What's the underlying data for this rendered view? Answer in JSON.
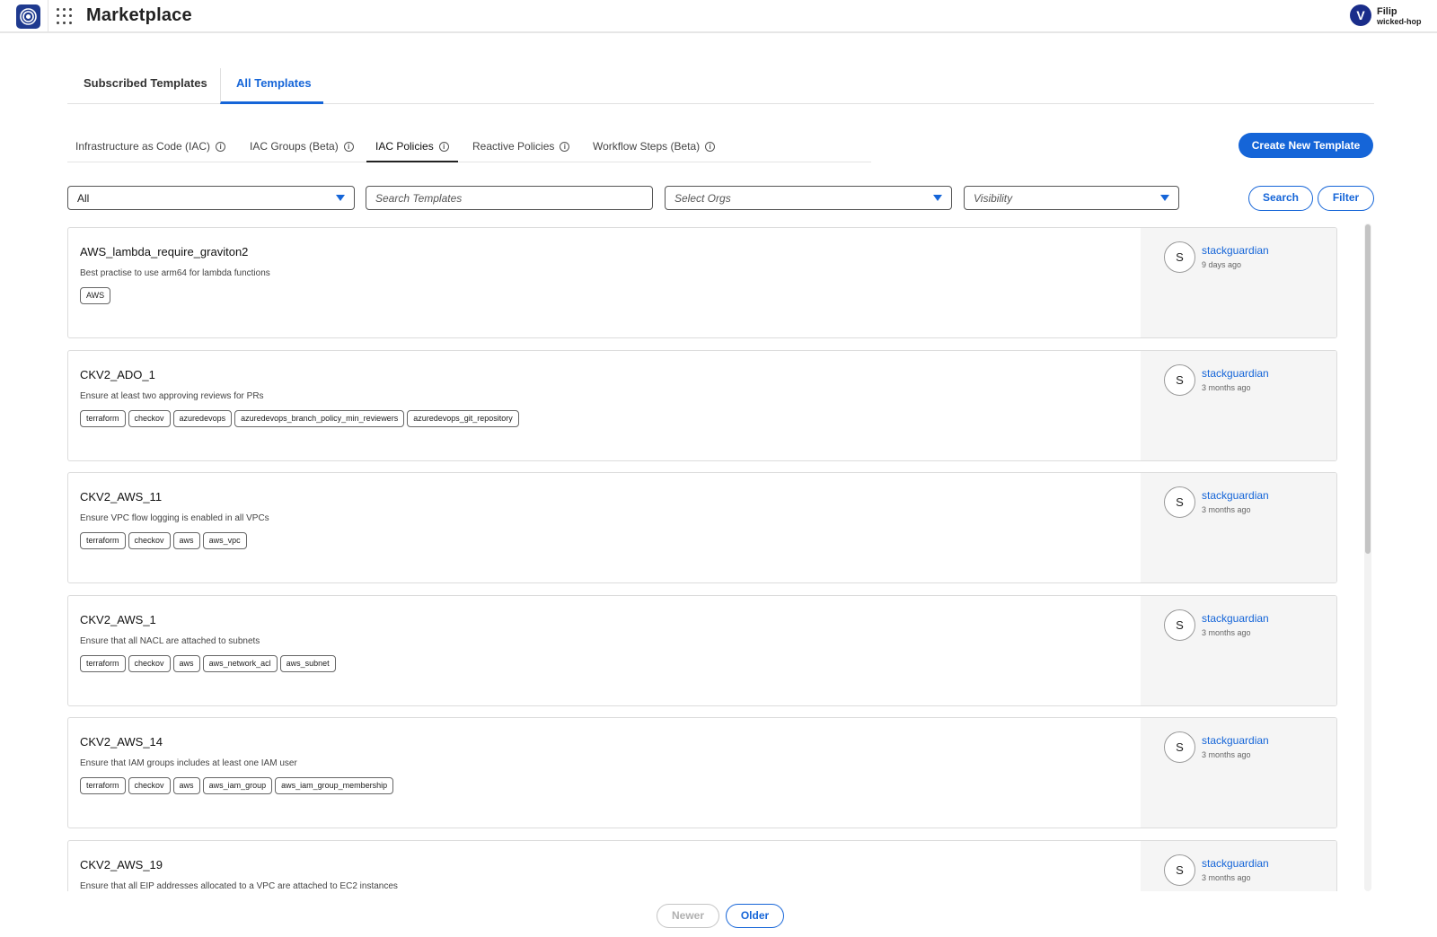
{
  "header": {
    "app_title": "Marketplace",
    "logo_icon": "stackguardian-logo-icon",
    "apps_icon": "apps-grid-icon",
    "user": {
      "avatar_letter": "V",
      "name": "Filip",
      "org": "wicked-hop"
    }
  },
  "main_tabs": [
    {
      "label": "Subscribed Templates",
      "active": false
    },
    {
      "label": "All Templates",
      "active": true
    }
  ],
  "sub_tabs": [
    {
      "label": "Infrastructure as Code (IAC)",
      "active": false
    },
    {
      "label": "IAC Groups (Beta)",
      "active": false
    },
    {
      "label": "IAC Policies",
      "active": true
    },
    {
      "label": "Reactive Policies",
      "active": false
    },
    {
      "label": "Workflow Steps (Beta)",
      "active": false
    }
  ],
  "info_icon": "i",
  "create_button": "Create New Template",
  "filters": {
    "type_select": "All",
    "search_placeholder": "Search Templates",
    "orgs_placeholder": "Select Orgs",
    "visibility_placeholder": "Visibility",
    "search_button": "Search",
    "filter_button": "Filter"
  },
  "templates": [
    {
      "title": "AWS_lambda_require_graviton2",
      "description": "Best practise to use arm64 for lambda functions",
      "tags": [
        "AWS"
      ],
      "author_initial": "S",
      "author": "stackguardian",
      "updated": "9 days ago"
    },
    {
      "title": "CKV2_ADO_1",
      "description": "Ensure at least two approving reviews for PRs",
      "tags": [
        "terraform",
        "checkov",
        "azuredevops",
        "azuredevops_branch_policy_min_reviewers",
        "azuredevops_git_repository"
      ],
      "author_initial": "S",
      "author": "stackguardian",
      "updated": "3 months ago"
    },
    {
      "title": "CKV2_AWS_11",
      "description": "Ensure VPC flow logging is enabled in all VPCs",
      "tags": [
        "terraform",
        "checkov",
        "aws",
        "aws_vpc"
      ],
      "author_initial": "S",
      "author": "stackguardian",
      "updated": "3 months ago"
    },
    {
      "title": "CKV2_AWS_1",
      "description": "Ensure that all NACL are attached to subnets",
      "tags": [
        "terraform",
        "checkov",
        "aws",
        "aws_network_acl",
        "aws_subnet"
      ],
      "author_initial": "S",
      "author": "stackguardian",
      "updated": "3 months ago"
    },
    {
      "title": "CKV2_AWS_14",
      "description": "Ensure that IAM groups includes at least one IAM user",
      "tags": [
        "terraform",
        "checkov",
        "aws",
        "aws_iam_group",
        "aws_iam_group_membership"
      ],
      "author_initial": "S",
      "author": "stackguardian",
      "updated": "3 months ago"
    },
    {
      "title": "CKV2_AWS_19",
      "description": "Ensure that all EIP addresses allocated to a VPC are attached to EC2 instances",
      "tags": [],
      "author_initial": "S",
      "author": "stackguardian",
      "updated": "3 months ago"
    }
  ],
  "pagination": {
    "newer": "Newer",
    "older": "Older"
  },
  "colors": {
    "accent": "#1565d8",
    "brand": "#1f3a8f",
    "avatar": "#1a2d8a"
  }
}
